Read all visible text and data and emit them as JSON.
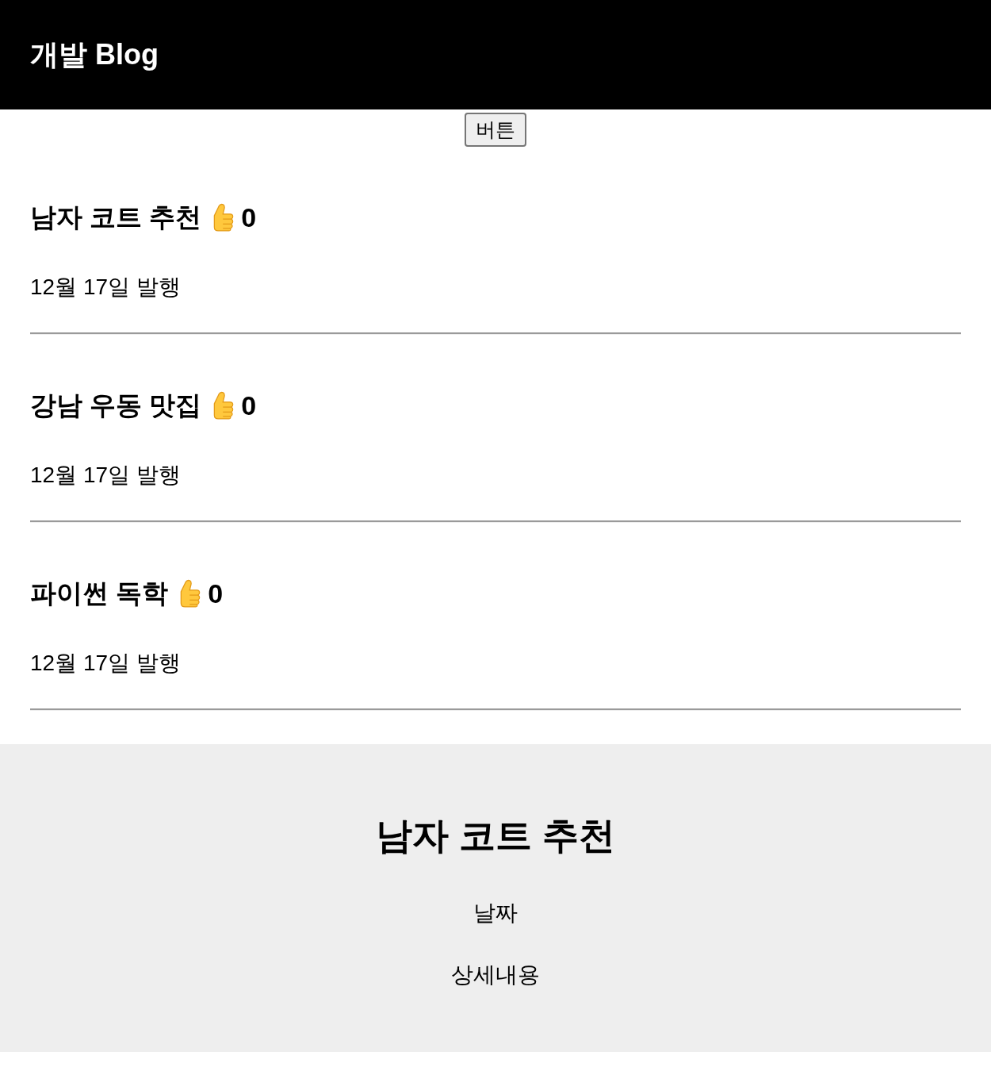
{
  "header": {
    "title": "개발 Blog"
  },
  "button": {
    "label": "버튼"
  },
  "posts": [
    {
      "title": "남자 코트 추천",
      "likes": "0",
      "date": "12월 17일 발행"
    },
    {
      "title": "강남 우동 맛집",
      "likes": "0",
      "date": "12월 17일 발행"
    },
    {
      "title": "파이썬 독학",
      "likes": "0",
      "date": "12월 17일 발행"
    }
  ],
  "modal": {
    "title": "남자 코트 추천",
    "date": "날짜",
    "detail": "상세내용"
  }
}
